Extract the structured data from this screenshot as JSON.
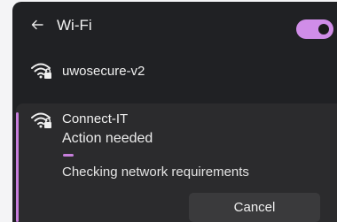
{
  "header": {
    "title": "Wi-Fi",
    "back_icon": "arrow-left-icon",
    "toggle_on": true
  },
  "networks": [
    {
      "name": "uwosecure-v2",
      "icon": "wifi-secure-icon"
    }
  ],
  "connecting": {
    "name": "Connect-IT",
    "icon": "wifi-secure-icon",
    "status": "Action needed",
    "checking_text": "Checking network requirements",
    "cancel_label": "Cancel"
  },
  "colors": {
    "accent": "#c77fdc",
    "panel": "#202124",
    "card": "#2b2b2d",
    "button": "#3a3a3c"
  }
}
